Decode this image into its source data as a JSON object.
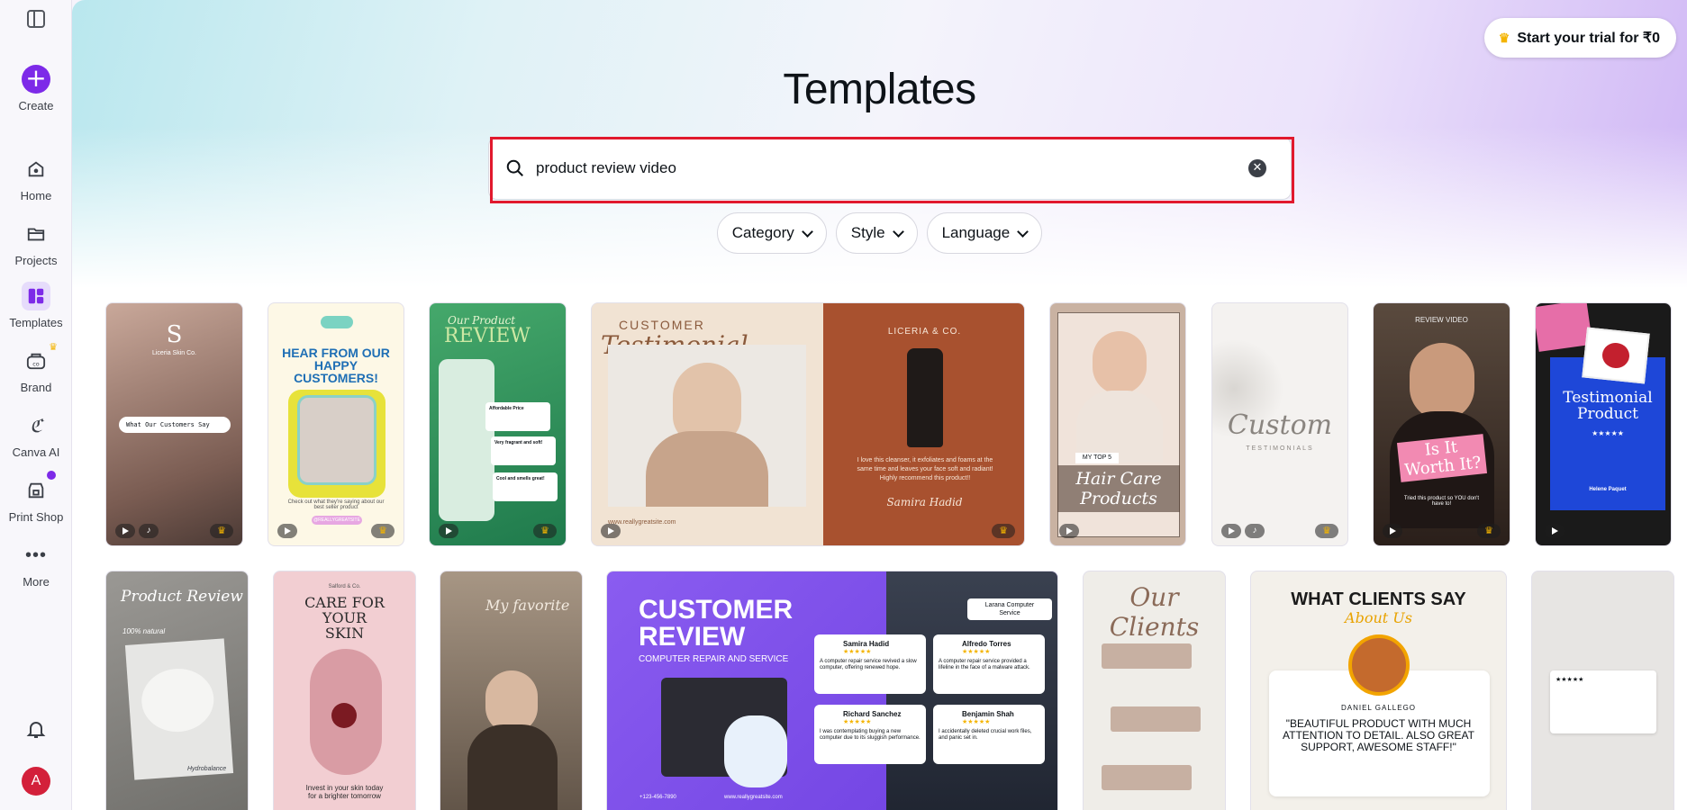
{
  "sidebar": {
    "create_label": "Create",
    "items": [
      {
        "label": "Home",
        "icon": "home-icon"
      },
      {
        "label": "Projects",
        "icon": "folder-icon"
      },
      {
        "label": "Templates",
        "icon": "templates-icon"
      },
      {
        "label": "Brand",
        "icon": "brand-icon"
      },
      {
        "label": "Canva AI",
        "icon": "canva-ai-icon"
      },
      {
        "label": "Print Shop",
        "icon": "print-shop-icon"
      },
      {
        "label": "More",
        "icon": "more-icon"
      }
    ],
    "avatar_initial": "A"
  },
  "header": {
    "trial_label": "Start your trial for ₹0",
    "title": "Templates"
  },
  "search": {
    "value": "product review video"
  },
  "filters": [
    {
      "label": "Category"
    },
    {
      "label": "Style"
    },
    {
      "label": "Language"
    }
  ],
  "templates_row1": [
    {
      "caption": "What Our Customers Say",
      "brand": "Liceria Skin Co."
    },
    {
      "caption": "HEAR FROM OUR HAPPY CUSTOMERS!",
      "sub": "Check out what they're saying about our best seller product",
      "tag": "@REALLYGREATSITE"
    },
    {
      "caption": "Our Product",
      "caption2": "REVIEW",
      "r1": "Affordable Price",
      "r2": "Very fragrant and soft!",
      "r3": "Cool and smells great!"
    },
    {
      "caption": "CUSTOMER",
      "caption2": "Testimonial",
      "brand": "LICERIA & CO.",
      "quote": "I love this cleanser, it exfoliates and foams at the same time and leaves your face soft and radiant! Highly recommend this product!!",
      "author": "Samira Hadid",
      "site": "www.reallygreatsite.com"
    },
    {
      "caption": "MY TOP 5",
      "caption2": "Hair Care Products"
    },
    {
      "caption": "Custom",
      "caption2": "TESTIMONIALS"
    },
    {
      "caption": "REVIEW VIDEO",
      "caption2": "Is It Worth It?",
      "sub": "Tried this product so YOU don't have to!"
    },
    {
      "caption": "Testimonial Product",
      "stars": "★★★★★",
      "author": "Helene Paquet"
    }
  ],
  "templates_row2": [
    {
      "caption": "Product Review",
      "sub": "100% natural",
      "sub2": "Hydrobalance"
    },
    {
      "caption": "CARE FOR YOUR SKIN",
      "brand": "Salford & Co.",
      "sub": "Invest in your skin today for a brighter tomorrow"
    },
    {
      "caption": "My favorite"
    },
    {
      "caption": "CUSTOMER REVIEW",
      "sub": "COMPUTER REPAIR AND SERVICE",
      "brand": "Larana Computer Service",
      "r1_name": "Samira Hadid",
      "r1_text": "A computer repair service revived a slow computer, offering renewed hope.",
      "r2_name": "Alfredo Torres",
      "r2_text": "A computer repair service provided a lifeline in the face of a malware attack.",
      "r3_name": "Richard Sanchez",
      "r3_text": "I was contemplating buying a new computer due to its sluggish performance.",
      "r4_name": "Benjamin Shah",
      "r4_text": "I accidentally deleted crucial work files, and panic set in.",
      "phone": "+123-456-7890",
      "site": "www.reallygreatsite.com"
    },
    {
      "caption": "Our Clients"
    },
    {
      "caption": "WHAT CLIENTS SAY",
      "caption2": "About Us",
      "author": "DANIEL GALLEGO",
      "quote": "\"BEAUTIFUL PRODUCT WITH MUCH ATTENTION TO DETAIL. ALSO GREAT SUPPORT, AWESOME STAFF!\""
    },
    {
      "caption": "★★★★★"
    }
  ],
  "colors": {
    "accent": "#7d2ae8",
    "highlight": "#e1192d",
    "crown": "#f4b400"
  }
}
